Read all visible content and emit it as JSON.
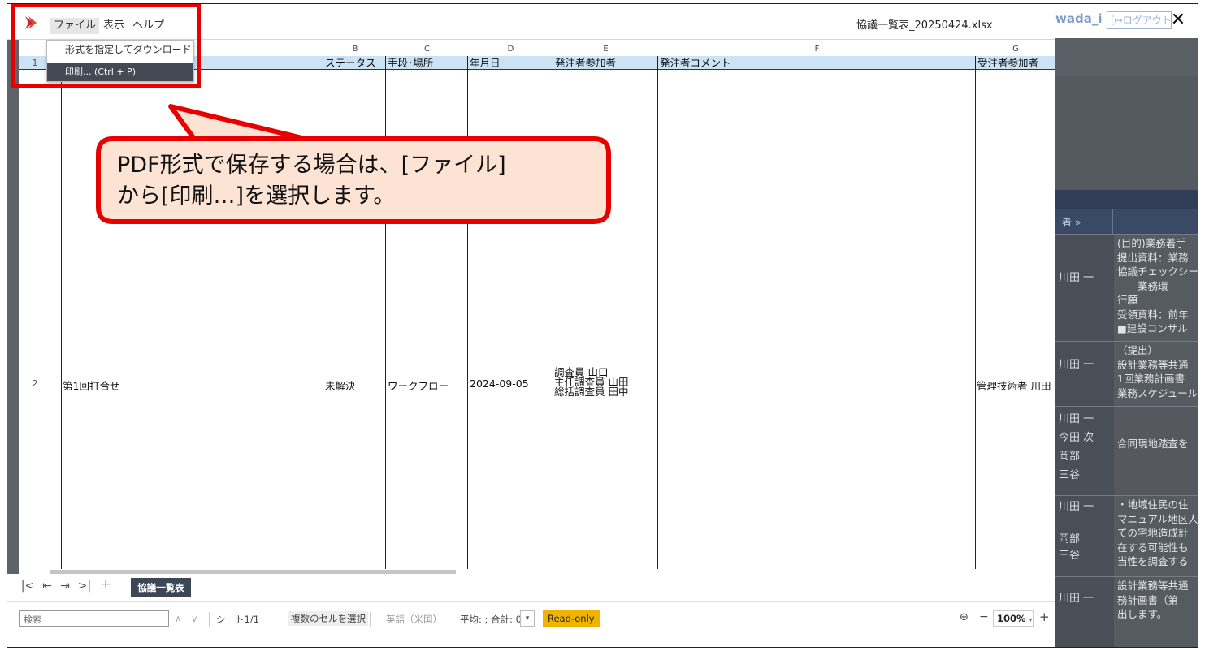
{
  "window": {
    "menu": [
      "ファイル",
      "表示",
      "ヘルプ"
    ],
    "filename": "協議一覧表_20250424.xlsx",
    "close_icon": "✕"
  },
  "file_menu": {
    "download_label": "形式を指定してダウンロード",
    "download_arrow": "›",
    "print_label": "印刷... (Ctrl + P)"
  },
  "columns": [
    "B",
    "C",
    "D",
    "E",
    "F",
    "G"
  ],
  "header_row": {
    "row_num": "1",
    "fields": [
      "ステータス",
      "手段･場所",
      "年月日",
      "発注者参加者",
      "発注者コメント",
      "受注者参加者"
    ]
  },
  "data_row": {
    "row_num": "2",
    "name": "第1回打合せ",
    "status": "未解決",
    "method": "ワークフロー",
    "date": "2024-09-05",
    "orderer_participants": [
      "調査員 山口",
      "主任調査員 山田",
      "総括調査員 田中"
    ],
    "contractor_participants": "管理技術者 川田"
  },
  "sheet_tab": "協議一覧表",
  "status_bar": {
    "search_placeholder": "検索",
    "sheet_count": "シート1/1",
    "multi_select": "複数のセルを選択",
    "language": "英語（米国）",
    "avg": "平均: ; 合計: 0",
    "readonly": "Read-only",
    "zoom": "100%",
    "zoom_minus": "−",
    "zoom_plus": "+"
  },
  "background": {
    "user": "wada_i",
    "logout": "[↦ログアウト",
    "header_arrow": "者 »",
    "rows": [
      {
        "name": "川田 一",
        "text": "(目的)業務着手\n提出資料：業務\n協議チェックシー\n　　業務環\n行願\n受領資料：前年\n■建設コンサル"
      },
      {
        "name": "川田 一",
        "text": "（提出）\n設計業務等共通\n1回業務計画書\n業務スケジュール"
      },
      {
        "name": "川田 一\n今田 次\n岡部\n三谷",
        "text": "\n\n合同現地踏査を"
      },
      {
        "name": "川田 一\n\n岡部\n三谷",
        "text": "・地域住民の住\nマニュアル地区人\nての宅地造成計\n在する可能性も\n当性を調査する"
      },
      {
        "name": "川田 一",
        "text": "設計業務等共通\n務計画書（第\n出します。"
      }
    ]
  },
  "callout": {
    "line1": "PDF形式で保存する場合は、[ファイル]",
    "line2": "から[印刷…]を選択します。"
  },
  "colors": {
    "accent_red": "#e60000",
    "callout_fill": "#fde3d3",
    "header_blue": "#cce3f5",
    "readonly_badge": "#f0b400"
  }
}
